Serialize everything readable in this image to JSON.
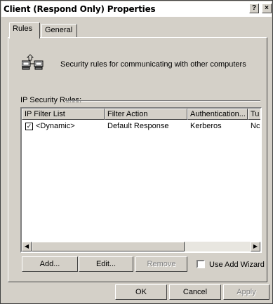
{
  "window": {
    "title": "Client (Respond Only) Properties",
    "help_label": "?",
    "close_label": "×"
  },
  "tabs": [
    {
      "label": "Rules"
    },
    {
      "label": "General"
    }
  ],
  "description": "Security rules for communicating with other computers",
  "rules_group": {
    "label": "IP Security Rules:"
  },
  "table": {
    "columns": [
      "IP Filter List",
      "Filter Action",
      "Authentication...",
      "Tu"
    ],
    "rows": [
      {
        "checked": true,
        "check_mark": "☑",
        "filter_list": "<Dynamic>",
        "filter_action": "Default Response",
        "authentication": "Kerberos",
        "tunnel": "Nc"
      }
    ]
  },
  "scroll": {
    "left_arrow": "◀",
    "right_arrow": "▶"
  },
  "buttons": {
    "add": "Add...",
    "edit": "Edit...",
    "remove": "Remove",
    "ok": "OK",
    "cancel": "Cancel",
    "apply": "Apply"
  },
  "use_wizard": {
    "label": "Use Add Wizard",
    "checked": false
  }
}
